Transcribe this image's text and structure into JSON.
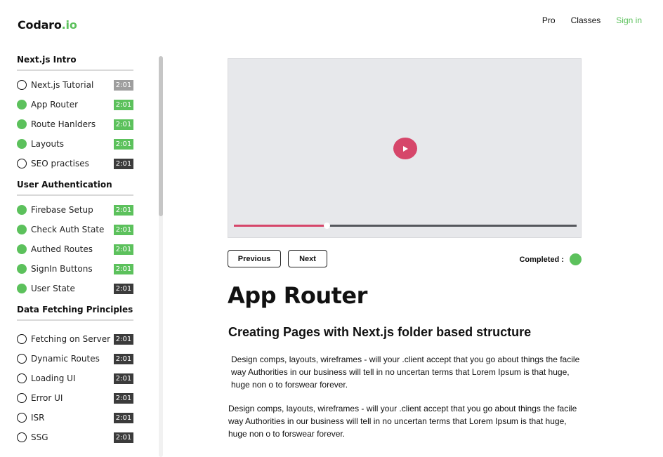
{
  "brand": {
    "name": "Codaro",
    "suffix": ".io",
    "accent_color": "#5cc15c"
  },
  "nav": {
    "pro": "Pro",
    "classes": "Classes",
    "signin": "Sign in"
  },
  "sidebar": {
    "sections": [
      {
        "title": "Next.js Intro",
        "lessons": [
          {
            "label": "Next.js Tutorial",
            "duration": "2:01",
            "status": "todo",
            "badge": "grey"
          },
          {
            "label": "App Router",
            "duration": "2:01",
            "status": "done",
            "badge": "green"
          },
          {
            "label": "Route Hanlders",
            "duration": "2:01",
            "status": "done",
            "badge": "green"
          },
          {
            "label": "Layouts",
            "duration": "2:01",
            "status": "done",
            "badge": "green"
          },
          {
            "label": "SEO practises",
            "duration": "2:01",
            "status": "todo",
            "badge": "dark"
          }
        ]
      },
      {
        "title": "User Authentication",
        "lessons": [
          {
            "label": "Firebase Setup",
            "duration": "2:01",
            "status": "done",
            "badge": "green"
          },
          {
            "label": "Check Auth State",
            "duration": "2:01",
            "status": "done",
            "badge": "green"
          },
          {
            "label": "Authed Routes",
            "duration": "2:01",
            "status": "done",
            "badge": "green"
          },
          {
            "label": "SignIn Buttons",
            "duration": "2:01",
            "status": "done",
            "badge": "green"
          },
          {
            "label": "User State",
            "duration": "2:01",
            "status": "done",
            "badge": "dark"
          }
        ]
      },
      {
        "title": "Data Fetching Principles",
        "lessons": [
          {
            "label": "Fetching on Server",
            "duration": "2:01",
            "status": "todo",
            "badge": "dark"
          },
          {
            "label": "Dynamic Routes",
            "duration": "2:01",
            "status": "todo",
            "badge": "dark"
          },
          {
            "label": "Loading UI",
            "duration": "2:01",
            "status": "todo",
            "badge": "dark"
          },
          {
            "label": "Error UI",
            "duration": "2:01",
            "status": "todo",
            "badge": "dark"
          },
          {
            "label": "ISR",
            "duration": "2:01",
            "status": "todo",
            "badge": "dark"
          },
          {
            "label": "SSG",
            "duration": "2:01",
            "status": "todo",
            "badge": "dark"
          }
        ]
      }
    ]
  },
  "player": {
    "icon": "play-icon",
    "progress": 0.27,
    "progress_color": "#d6466a"
  },
  "controls": {
    "previous": "Previous",
    "next": "Next",
    "completed_label": "Completed :"
  },
  "lesson": {
    "title": "App Router",
    "subtitle": "Creating Pages with Next.js folder based structure",
    "paragraphs": [
      "Design comps, layouts, wireframes - will your .client accept that you go about things the facile way Authorities in our business will tell in no uncertan terms that Lorem Ipsum is that huge, huge non o to forswear forever.",
      "Design comps, layouts, wireframes - will your .client accept that you go about things the facile way Authorities in our business will tell in no uncertan terms that Lorem Ipsum is that huge, huge non o to forswear forever."
    ]
  }
}
